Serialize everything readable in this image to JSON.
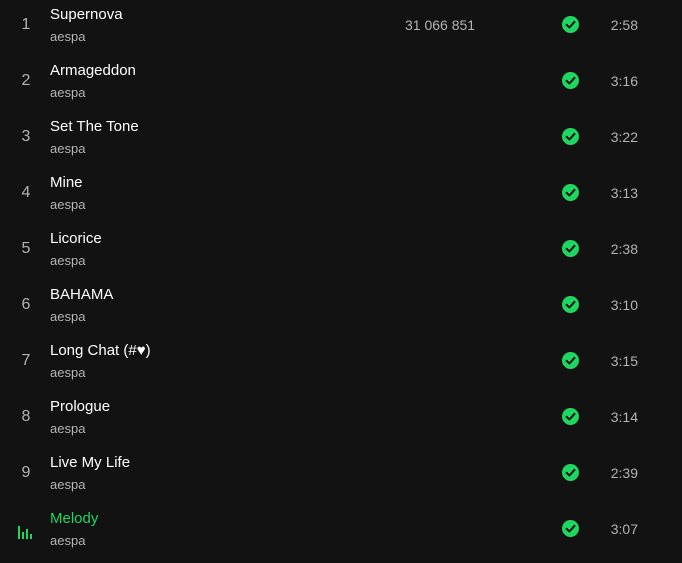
{
  "colors": {
    "background": "#121212",
    "text_primary": "#ffffff",
    "text_secondary": "#b3b3b3",
    "accent": "#1ed760"
  },
  "tracks": [
    {
      "number": "1",
      "title": "Supernova",
      "artist": "aespa",
      "plays": "31 066 851",
      "duration": "2:58",
      "saved": true,
      "playing": false
    },
    {
      "number": "2",
      "title": "Armageddon",
      "artist": "aespa",
      "plays": "",
      "duration": "3:16",
      "saved": true,
      "playing": false
    },
    {
      "number": "3",
      "title": "Set The Tone",
      "artist": "aespa",
      "plays": "",
      "duration": "3:22",
      "saved": true,
      "playing": false
    },
    {
      "number": "4",
      "title": "Mine",
      "artist": "aespa",
      "plays": "",
      "duration": "3:13",
      "saved": true,
      "playing": false
    },
    {
      "number": "5",
      "title": "Licorice",
      "artist": "aespa",
      "plays": "",
      "duration": "2:38",
      "saved": true,
      "playing": false
    },
    {
      "number": "6",
      "title": "BAHAMA",
      "artist": "aespa",
      "plays": "",
      "duration": "3:10",
      "saved": true,
      "playing": false
    },
    {
      "number": "7",
      "title": "Long Chat (#♥)",
      "artist": "aespa",
      "plays": "",
      "duration": "3:15",
      "saved": true,
      "playing": false
    },
    {
      "number": "8",
      "title": "Prologue",
      "artist": "aespa",
      "plays": "",
      "duration": "3:14",
      "saved": true,
      "playing": false
    },
    {
      "number": "9",
      "title": "Live My Life",
      "artist": "aespa",
      "plays": "",
      "duration": "2:39",
      "saved": true,
      "playing": false
    },
    {
      "number": "",
      "title": "Melody",
      "artist": "aespa",
      "plays": "",
      "duration": "3:07",
      "saved": true,
      "playing": true,
      "playing_icon": "equalizer-icon"
    }
  ],
  "icons": {
    "saved": "check-circle-icon",
    "now_playing": "equalizer-icon"
  }
}
